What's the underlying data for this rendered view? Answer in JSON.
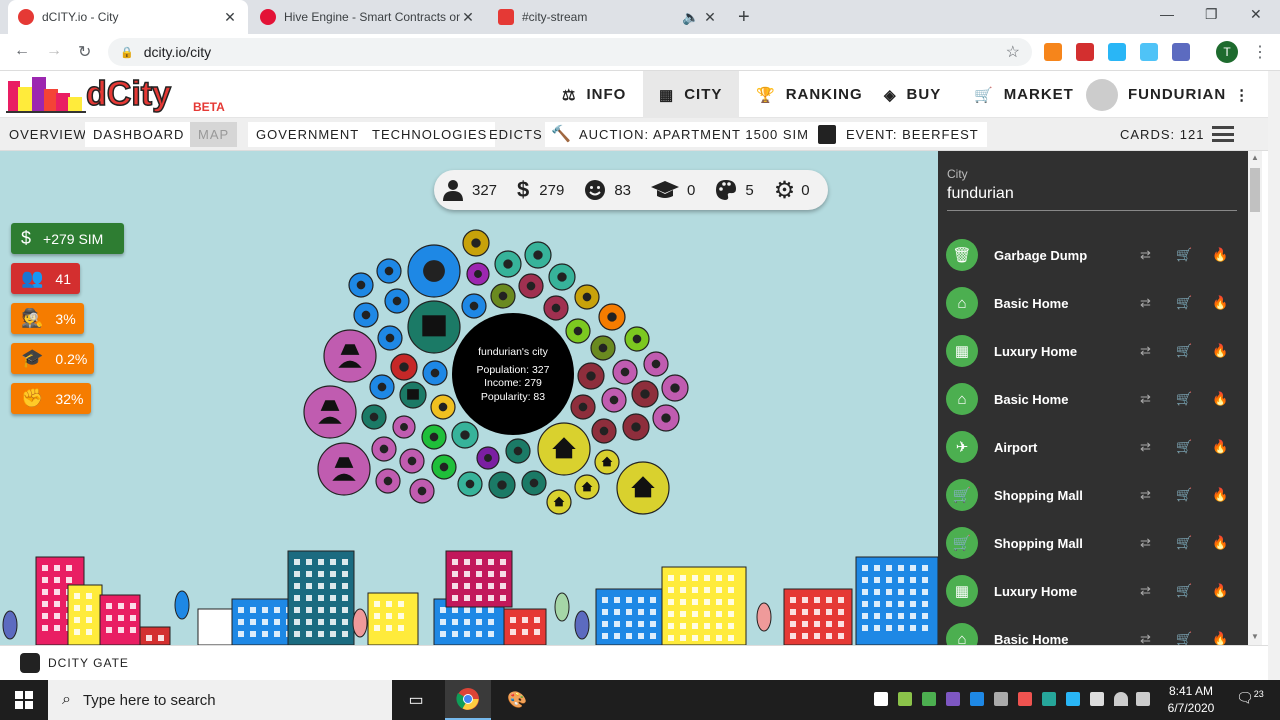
{
  "browser": {
    "tabs": [
      {
        "title": "dCITY.io - City",
        "active": true,
        "color": "#e53935"
      },
      {
        "title": "Hive Engine - Smart Contracts on",
        "active": false,
        "color": "#e31337"
      },
      {
        "title": "#city-stream",
        "active": false,
        "color": "#e53935"
      }
    ],
    "url": "dcity.io/city",
    "profile_initial": "T"
  },
  "app": {
    "logo_text": "dCity",
    "logo_badge": "BETA",
    "nav": [
      {
        "label": "INFO",
        "icon": "balance-scale-icon"
      },
      {
        "label": "CITY",
        "icon": "city-icon",
        "active": true
      },
      {
        "label": "RANKING",
        "icon": "trophy-icon"
      },
      {
        "label": "BUY",
        "icon": "layers-icon"
      },
      {
        "label": "MARKET",
        "icon": "cart-icon"
      },
      {
        "label": "FUNDURIAN",
        "icon": "avatar"
      }
    ],
    "subnav": {
      "overview": "OVERVIEW",
      "dashboard": "DASHBOARD",
      "map": "MAP",
      "government": "GOVERNMENT",
      "technologies": "TECHNOLOGIES",
      "edicts": "EDICTS",
      "auction": "AUCTION: APARTMENT 1500 SIM",
      "event": "EVENT: BEERFEST",
      "cards": "CARDS: 121"
    }
  },
  "stats": {
    "population": "327",
    "income": "279",
    "popularity": "83",
    "education": "0",
    "creativity": "5",
    "technology": "0"
  },
  "badges": [
    {
      "label": "+279 SIM",
      "color": "#2e7d32",
      "icon": "dollar-icon"
    },
    {
      "label": "41",
      "color": "#d32f2f",
      "icon": "users-icon"
    },
    {
      "label": "3%",
      "color": "#f57c00",
      "icon": "criminal-icon"
    },
    {
      "label": "0.2%",
      "color": "#f57c00",
      "icon": "graduation-icon"
    },
    {
      "label": "32%",
      "color": "#f57c00",
      "icon": "fist-icon"
    }
  ],
  "center": {
    "name": "fundurian's city",
    "population": "Population: 327",
    "income": "Income: 279",
    "popularity": "Popularity: 83"
  },
  "sidebar": {
    "label": "City",
    "city": "fundurian",
    "cards": [
      {
        "name": "Garbage Dump",
        "icon": "trash-icon"
      },
      {
        "name": "Basic Home",
        "icon": "home-icon"
      },
      {
        "name": "Luxury Home",
        "icon": "building-icon"
      },
      {
        "name": "Basic Home",
        "icon": "home-icon"
      },
      {
        "name": "Airport",
        "icon": "plane-icon"
      },
      {
        "name": "Shopping Mall",
        "icon": "cart-icon"
      },
      {
        "name": "Shopping Mall",
        "icon": "cart-icon"
      },
      {
        "name": "Luxury Home",
        "icon": "building-icon"
      },
      {
        "name": "Basic Home",
        "icon": "home-icon"
      }
    ]
  },
  "footer": {
    "label": "DCITY GATE"
  },
  "taskbar": {
    "search_placeholder": "Type here to search",
    "time": "8:41 AM",
    "date": "6/7/2020",
    "notif": "23"
  }
}
